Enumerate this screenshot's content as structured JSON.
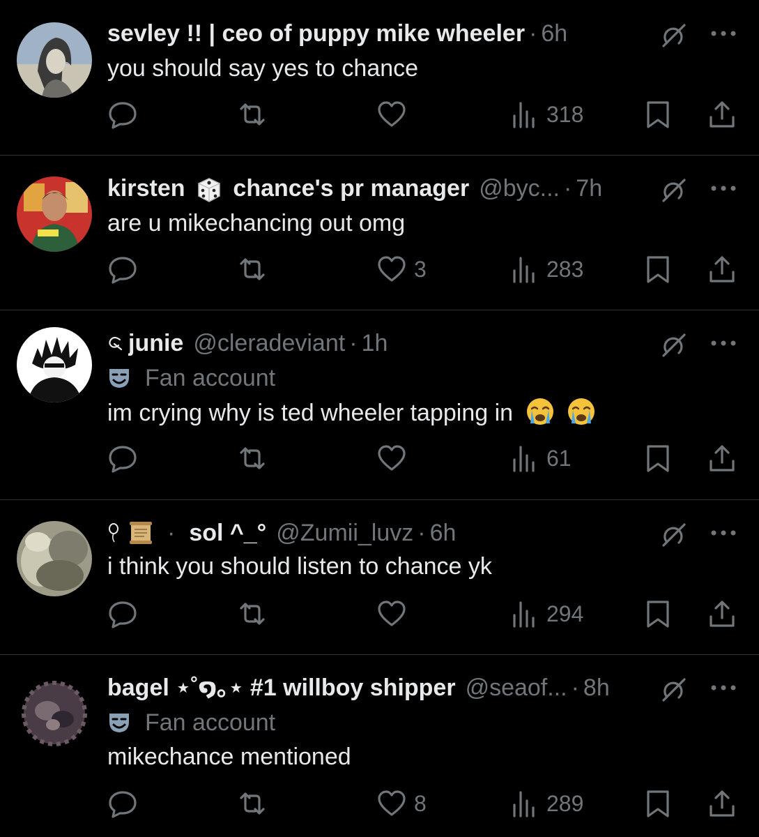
{
  "replies": [
    {
      "name": "sevley !! | ceo of puppy mike wheeler",
      "name_parts": [
        "sevley !! | ceo of puppy mike wheeler"
      ],
      "handle": "",
      "sep": "·",
      "time": "6h",
      "fan_badge": "",
      "text": "you should say yes to chance",
      "counts": {
        "replies": "",
        "reposts": "",
        "likes": "",
        "views": "318"
      },
      "avatar_icon": "avatar-sketch-portrait"
    },
    {
      "name_a": "kirsten",
      "name_b": "chance's pr manager",
      "name_icon": "dice-icon",
      "handle": "@byc...",
      "sep": "·",
      "time": "7h",
      "fan_badge": "",
      "text": "are u mikechancing out omg",
      "counts": {
        "replies": "",
        "reposts": "",
        "likes": "3",
        "views": "283"
      },
      "avatar_icon": "avatar-photo-person"
    },
    {
      "name": "junie",
      "name_prefix_icon": "flourish-icon",
      "handle": "@cleradeviant",
      "sep": "·",
      "time": "1h",
      "fan_badge": "Fan account",
      "text": "im crying why is ted wheeler tapping in",
      "text_emoji": "loudly-crying-face-emoji",
      "counts": {
        "replies": "",
        "reposts": "",
        "likes": "",
        "views": "61"
      },
      "avatar_icon": "avatar-anime-drawing"
    },
    {
      "name": "sol ^_°",
      "name_prefix_icons": [
        "balloon-icon",
        "scroll-icon"
      ],
      "name_dot": "·",
      "handle": "@Zumii_luvz",
      "sep": "·",
      "time": "6h",
      "fan_badge": "",
      "text": "i think you should listen to chance yk",
      "counts": {
        "replies": "",
        "reposts": "",
        "likes": "",
        "views": "294"
      },
      "avatar_icon": "avatar-soft-photo"
    },
    {
      "name": "bagel ⋆˚໑｡⋆ #1 willboy shipper",
      "handle": "@seaof...",
      "sep": "·",
      "time": "8h",
      "fan_badge": "Fan account",
      "text": "mikechance mentioned",
      "counts": {
        "replies": "",
        "reposts": "",
        "likes": "8",
        "views": "289"
      },
      "avatar_icon": "avatar-dark-artwork"
    }
  ],
  "icons": {
    "reply": "reply-icon",
    "repost": "repost-icon",
    "like": "heart-icon",
    "views": "views-icon",
    "bookmark": "bookmark-icon",
    "share": "share-icon",
    "grok": "grok-icon",
    "more": "more-icon",
    "fan": "theater-mask-icon"
  },
  "colors": {
    "background": "#000000",
    "text": "#e7e9ea",
    "muted": "#71767b",
    "divider": "#2f3336"
  }
}
